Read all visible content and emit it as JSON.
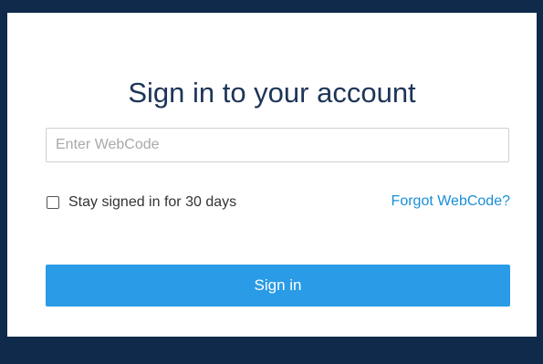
{
  "login": {
    "title": "Sign in to your account",
    "webcode_placeholder": "Enter WebCode",
    "webcode_value": "",
    "stay_signed_in_label": "Stay signed in for 30 days",
    "stay_signed_in_checked": false,
    "forgot_link_label": "Forgot WebCode?",
    "sign_in_button_label": "Sign in"
  },
  "colors": {
    "page_background": "#0f2a4a",
    "card_background": "#ffffff",
    "title_text": "#1d3557",
    "link": "#1a8fd8",
    "primary_button": "#2a9be6"
  }
}
